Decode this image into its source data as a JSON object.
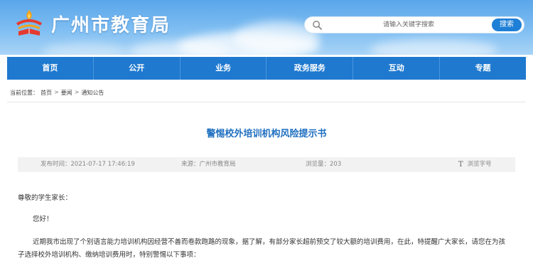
{
  "header": {
    "site_title": "广州市教育局",
    "search": {
      "placeholder": "请输入关键字搜索",
      "button_label": "搜索"
    }
  },
  "nav": {
    "items": [
      {
        "label": "首页"
      },
      {
        "label": "公开"
      },
      {
        "label": "业务"
      },
      {
        "label": "政务服务"
      },
      {
        "label": "互动"
      },
      {
        "label": "专题"
      }
    ]
  },
  "breadcrumb": {
    "prefix": "当前位置：",
    "items": [
      "首页",
      "要闻",
      "通知公告"
    ],
    "separator": ">"
  },
  "article": {
    "title": "警惕校外培训机构风险提示书",
    "meta": {
      "date": "发布时间：2021-07-17 17:46:19",
      "source": "来源：广州市教育局",
      "views": "浏览量：203",
      "font_size_icon": "T",
      "font_size_label": "浏览字号"
    },
    "greeting": "尊敬的学生家长：",
    "hello": "您好！",
    "para_line1": "近期我市出现了个别语言能力培训机构因经营不善而卷款跑路的现象，据了解，有部分家长超前预交了较大额的培训费用，在此，特提醒广大家长，请您在为孩",
    "para_line2": "子选择校外培训机构、缴纳培训费用时，特别警惕以下事项："
  },
  "colors": {
    "nav_bg": "#1f79cf",
    "title_blue": "#1f6fc0",
    "search_button": "#1e7fd6"
  }
}
